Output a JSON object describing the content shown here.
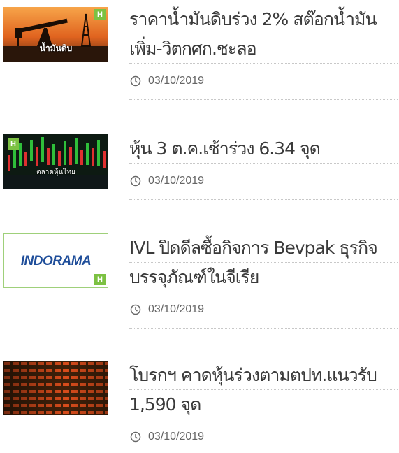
{
  "colors": {
    "accent_green": "#7cc142",
    "title_text": "#3a3a3a",
    "meta_text": "#666666",
    "divider": "#c8c8c8",
    "logo_blue": "#1f4e9a"
  },
  "articles": [
    {
      "title_line1": "ราคาน้ำมันดิบร่วง 2% สต๊อกน้ำมัน",
      "title_line2": "เพิ่ม-วิตกศก.ชะลอ",
      "date": "03/10/2019",
      "thumb_caption": "น้ำมันดิบ",
      "badge": "H",
      "thumb_icon": "oil-pump-image"
    },
    {
      "title_line1": "หุ้น 3 ต.ค.เช้าร่วง 6.34 จุด",
      "date": "03/10/2019",
      "thumb_caption": "ตลาดหุ้นไทย",
      "badge": "H",
      "thumb_icon": "stock-chart-image"
    },
    {
      "title_line1": "IVL ปิดดีลซื้อกิจการ Bevpak ธุรกิจ",
      "title_line2": "บรรจุภัณฑ์ในจีเรีย",
      "date": "03/10/2019",
      "thumb_caption": "INDORAMA",
      "badge": "H",
      "thumb_icon": "indorama-logo"
    },
    {
      "title_line1": "โบรกฯ คาดหุ้นร่วงตามตปท.แนวรับ",
      "title_line2": "1,590 จุด",
      "date": "03/10/2019",
      "badge": "",
      "thumb_icon": "stock-board-image"
    }
  ]
}
